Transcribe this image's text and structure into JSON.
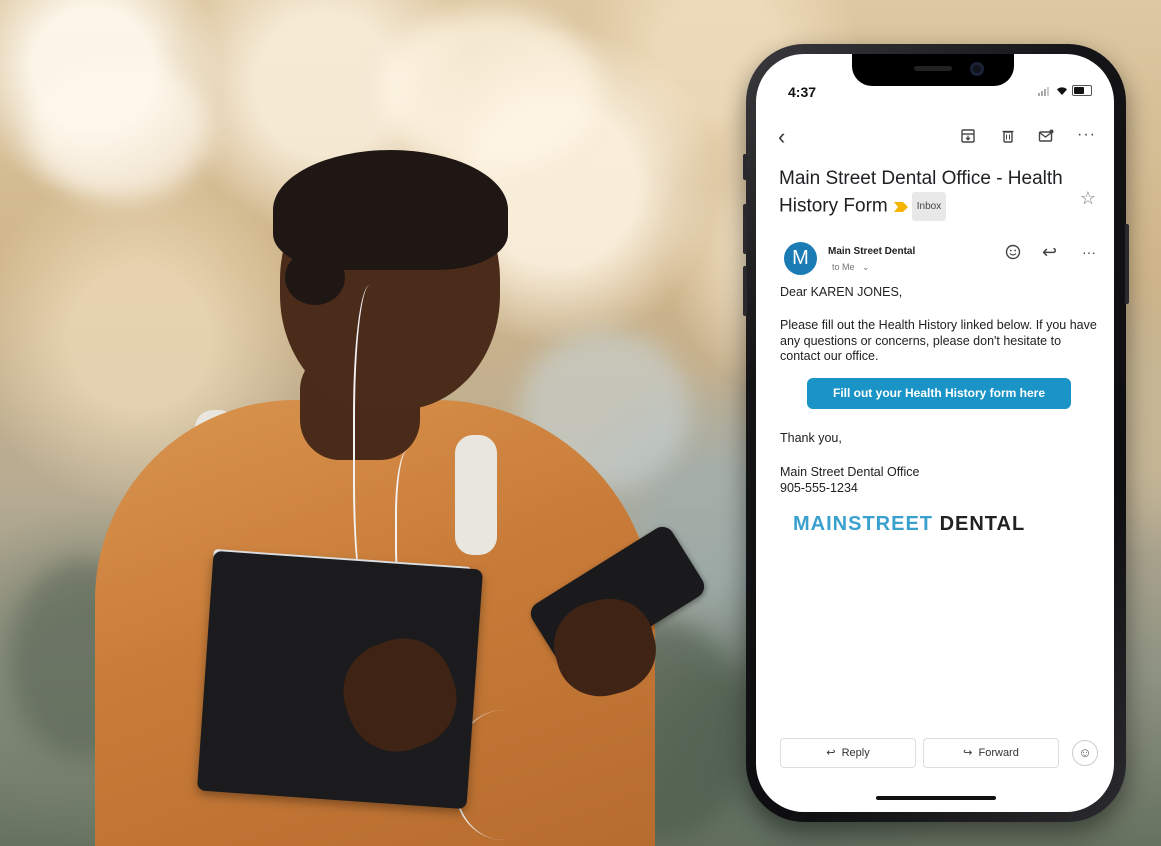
{
  "status_bar": {
    "time": "4:37"
  },
  "email": {
    "subject": "Main Street Dental Office - Health History Form",
    "label": "Inbox",
    "sender_initial": "M",
    "sender_name": "Main Street Dental",
    "recipient": "to Me",
    "greeting": "Dear KAREN JONES,",
    "paragraph": "Please fill out the Health History linked below. If you have any questions or concerns, please don't hesitate to contact our office.",
    "cta_label": "Fill out your Health History form here",
    "closing": "Thank you,",
    "signature_name": "Main Street Dental Office",
    "signature_phone": "905-555-1234",
    "logo_part1": "MAINSTREET",
    "logo_part2": "DENTAL"
  },
  "actions": {
    "reply": "Reply",
    "forward": "Forward"
  },
  "colors": {
    "cta": "#1a94c6",
    "avatar": "#1a7bb5",
    "logo_accent": "#3aa1cf",
    "important_marker": "#f4b400"
  },
  "icons": [
    "back-icon",
    "archive-icon",
    "trash-icon",
    "mark-unread-icon",
    "more-icon",
    "star-icon",
    "emoji-icon",
    "reply-icon",
    "forward-icon",
    "important-marker-icon"
  ]
}
